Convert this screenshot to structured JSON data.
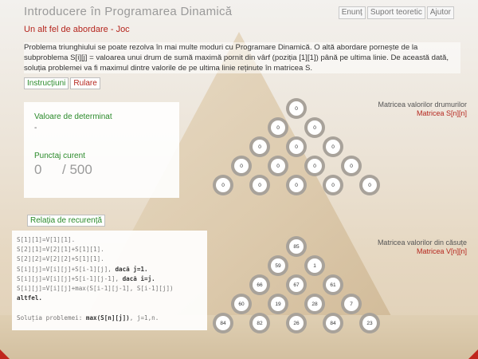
{
  "app": {
    "title": "Introducere în Programarea Dinamică",
    "nav": [
      "Enunț",
      "Suport teoretic",
      "Ajutor"
    ]
  },
  "subtitle": "Un alt fel de abordare - Joc",
  "description": "Problema triunghiului se poate rezolva în mai multe moduri cu Programare Dinamică. O altă abordare pornește de la subproblema S[i][j] = valoarea unui drum de sumă maximă pornit din vârf (poziția [1][1]) până pe ultima linie. De această dată, soluția problemei va fi maximul dintre valorile de pe ultima linie reținute în matricea S.",
  "buttons": {
    "instructions": "Instrucțiuni",
    "run": "Rulare",
    "recurrence": "Relația de recurență"
  },
  "status": {
    "value_label": "Valoare de determinat",
    "value": "-",
    "score_label": "Punctaj curent",
    "score_current": "0",
    "score_total": "/ 500"
  },
  "code_lines": [
    [
      "S[1][1]=V[1][1].",
      ""
    ],
    [
      "S[2][1]=V[2][1]+S[1][1].",
      ""
    ],
    [
      "S[2][2]=V[2][2]+S[1][1].",
      ""
    ],
    [
      "S[i][j]=V[i][j]+S[i-1][j], ",
      "dacă j=1."
    ],
    [
      "S[i][j]=V[i][j]+S[i-1][j-1], ",
      "dacă i=j."
    ],
    [
      "S[i][j]=V[i][j]+max(S[i-1][j-1], S[i-1][j])",
      ""
    ],
    [
      "",
      "altfel."
    ],
    [
      "",
      ""
    ],
    [
      "Soluția problemei: ",
      "max(S[n][j])",
      ", j=1,n."
    ]
  ],
  "matrix_s": {
    "title": "Matricea valorilor drumurilor",
    "name": "Matricea S[n][n]",
    "rows": [
      [
        "0"
      ],
      [
        "0",
        "0"
      ],
      [
        "0",
        "0",
        "0"
      ],
      [
        "0",
        "0",
        "0",
        "0"
      ],
      [
        "0",
        "0",
        "0",
        "0",
        "0"
      ]
    ]
  },
  "matrix_v": {
    "title": "Matricea valorilor din căsuțe",
    "name": "Matricea V[n][n]",
    "rows": [
      [
        "85"
      ],
      [
        "59",
        "1"
      ],
      [
        "66",
        "67",
        "61"
      ],
      [
        "60",
        "19",
        "28",
        "7"
      ],
      [
        "84",
        "82",
        "26",
        "84",
        "23"
      ]
    ]
  }
}
